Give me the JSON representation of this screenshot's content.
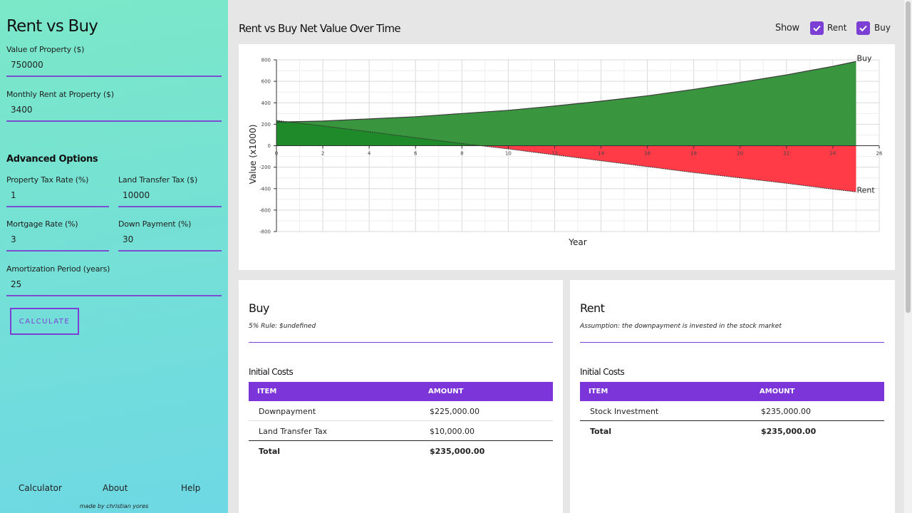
{
  "sidebar": {
    "title": "Rent vs Buy",
    "fields": {
      "property_value": {
        "label": "Value of Property ($)",
        "value": "750000"
      },
      "monthly_rent": {
        "label": "Monthly Rent at Property ($)",
        "value": "3400"
      }
    },
    "advanced_title": "Advanced Options",
    "advanced": {
      "property_tax": {
        "label": "Property Tax Rate (%)",
        "value": "1"
      },
      "land_transfer": {
        "label": "Land Transfer Tax ($)",
        "value": "10000"
      },
      "mortgage_rate": {
        "label": "Mortgage Rate (%)",
        "value": "3"
      },
      "down_payment": {
        "label": "Down Payment (%)",
        "value": "30"
      },
      "amortization": {
        "label": "Amortization Period (years)",
        "value": "25"
      }
    },
    "calculate_label": "CALCULATE",
    "nav": [
      "Calculator",
      "About",
      "Help"
    ],
    "credit": "made by christian yores"
  },
  "chart_header": {
    "title": "Rent vs Buy Net Value Over Time",
    "show_label": "Show",
    "toggles": [
      {
        "label": "Rent",
        "checked": true
      },
      {
        "label": "Buy",
        "checked": true
      }
    ]
  },
  "chart_data": {
    "type": "area",
    "xlabel": "Year",
    "ylabel": "Value (x1000)",
    "xlim": [
      0,
      26
    ],
    "ylim": [
      -800,
      800
    ],
    "x_ticks": [
      "0",
      "2",
      "4",
      "6",
      "8",
      "10",
      "12",
      "14",
      "16",
      "18",
      "20",
      "22",
      "24",
      "26"
    ],
    "y_ticks": [
      "800",
      "600",
      "400",
      "200",
      "0",
      "-200",
      "-400",
      "-600",
      "-800"
    ],
    "grid": true,
    "colors": {
      "buy": "#39963f",
      "rent": "#ff3b48",
      "rent_positive": "#1f8a2a"
    },
    "series": [
      {
        "name": "Buy",
        "x": [
          0,
          2,
          4,
          6,
          8,
          10,
          12,
          14,
          16,
          18,
          20,
          22,
          24,
          25
        ],
        "values": [
          220,
          230,
          250,
          270,
          300,
          330,
          370,
          415,
          465,
          525,
          590,
          660,
          740,
          785
        ]
      },
      {
        "name": "Rent",
        "x": [
          0,
          2,
          4,
          6,
          8,
          10,
          12,
          14,
          16,
          18,
          20,
          22,
          24,
          25
        ],
        "values": [
          235,
          185,
          130,
          75,
          20,
          -30,
          -85,
          -140,
          -195,
          -250,
          -300,
          -350,
          -405,
          -430
        ]
      }
    ]
  },
  "buy_panel": {
    "title": "Buy",
    "subtitle": "5% Rule: $undefined",
    "section": "Initial Costs",
    "headers": [
      "ITEM",
      "AMOUNT"
    ],
    "rows": [
      {
        "item": "Downpayment",
        "amount": "$225,000.00"
      },
      {
        "item": "Land Transfer Tax",
        "amount": "$10,000.00"
      }
    ],
    "total": {
      "item": "Total",
      "amount": "$235,000.00"
    }
  },
  "rent_panel": {
    "title": "Rent",
    "subtitle": "Assumption: the downpayment is invested in the stock market",
    "section": "Initial Costs",
    "headers": [
      "ITEM",
      "AMOUNT"
    ],
    "rows": [
      {
        "item": "Stock Investment",
        "amount": "$235,000.00"
      }
    ],
    "total": {
      "item": "Total",
      "amount": "$235,000.00"
    }
  }
}
